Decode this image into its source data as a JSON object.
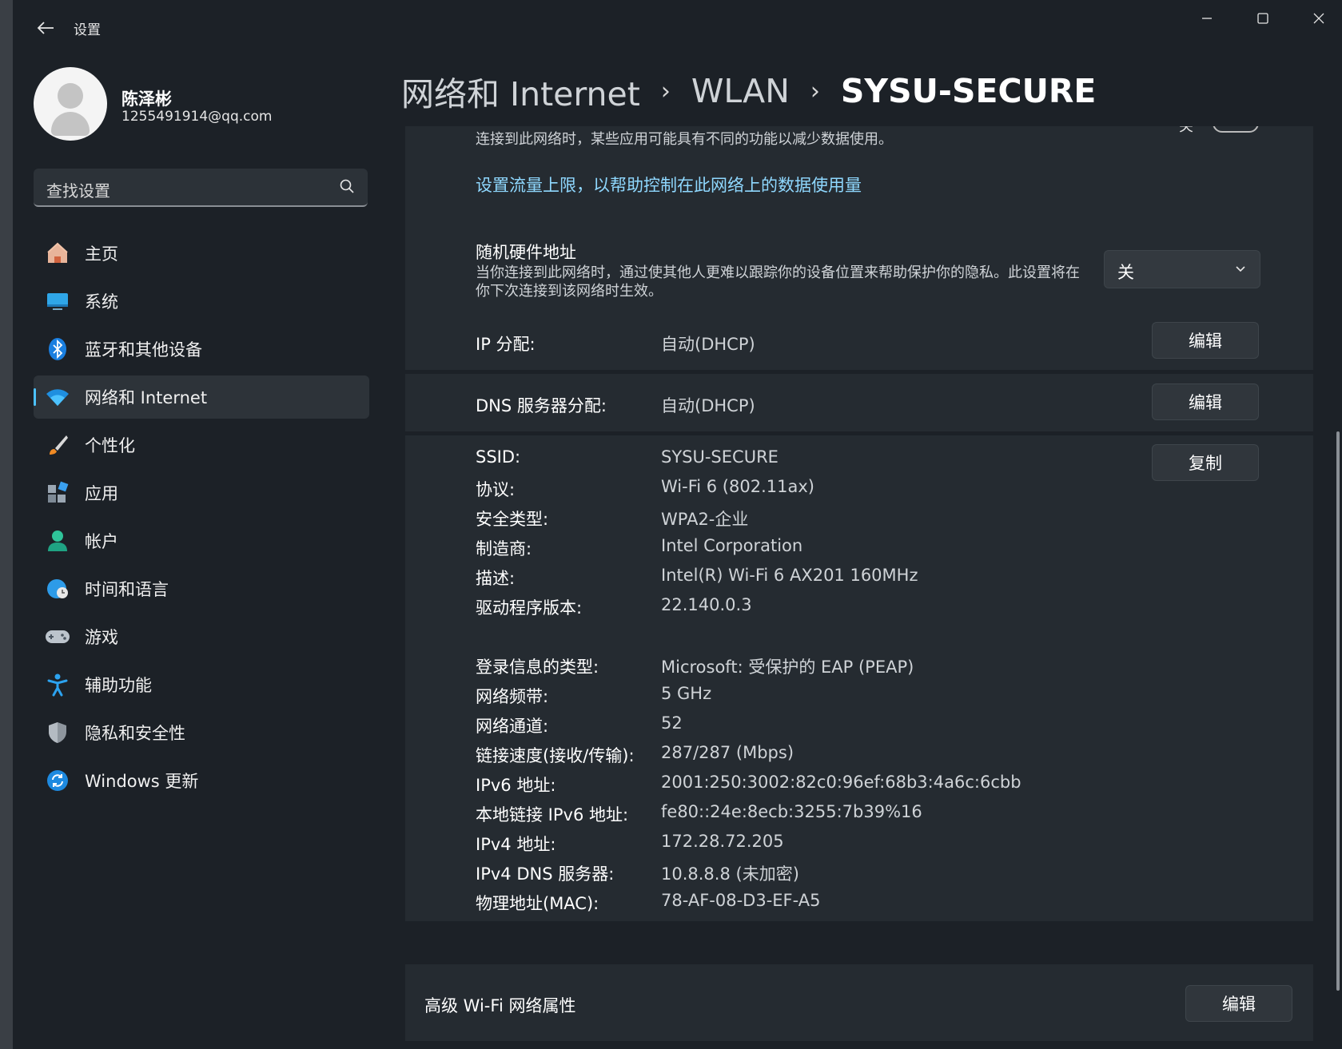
{
  "titlebar": {
    "app_title": "设置"
  },
  "profile": {
    "name": "陈泽彬",
    "email": "1255491914@qq.com"
  },
  "search": {
    "placeholder": "查找设置"
  },
  "nav": [
    {
      "label": "主页",
      "icon": "home-icon"
    },
    {
      "label": "系统",
      "icon": "system-icon"
    },
    {
      "label": "蓝牙和其他设备",
      "icon": "bluetooth-icon"
    },
    {
      "label": "网络和 Internet",
      "icon": "wifi-icon",
      "active": true
    },
    {
      "label": "个性化",
      "icon": "brush-icon"
    },
    {
      "label": "应用",
      "icon": "apps-icon"
    },
    {
      "label": "帐户",
      "icon": "account-icon"
    },
    {
      "label": "时间和语言",
      "icon": "time-language-icon"
    },
    {
      "label": "游戏",
      "icon": "gamepad-icon"
    },
    {
      "label": "辅助功能",
      "icon": "accessibility-icon"
    },
    {
      "label": "隐私和安全性",
      "icon": "shield-icon"
    },
    {
      "label": "Windows 更新",
      "icon": "update-icon"
    }
  ],
  "breadcrumb": {
    "level1": "网络和 Internet",
    "level2": "WLAN",
    "level3": "SYSU-SECURE"
  },
  "metered": {
    "description": "连接到此网络时，某些应用可能具有不同的功能以减少数据使用。",
    "toggle_state": "关",
    "data_limit_link": "设置流量上限，以帮助控制在此网络上的数据使用量"
  },
  "random_hw": {
    "title": "随机硬件地址",
    "description": "当你连接到此网络时，通过使其他人更难以跟踪你的设备位置来帮助保护你的隐私。此设置将在你下次连接到该网络时生效。",
    "value": "关"
  },
  "ip_assignment": {
    "label": "IP 分配:",
    "value": "自动(DHCP)",
    "button": "编辑"
  },
  "dns_assignment": {
    "label": "DNS 服务器分配:",
    "value": "自动(DHCP)",
    "button": "编辑"
  },
  "details": {
    "copy_button": "复制",
    "group1": [
      {
        "label": "SSID:",
        "value": "SYSU-SECURE"
      },
      {
        "label": "协议:",
        "value": "Wi-Fi 6 (802.11ax)"
      },
      {
        "label": "安全类型:",
        "value": "WPA2-企业"
      },
      {
        "label": "制造商:",
        "value": "Intel Corporation"
      },
      {
        "label": "描述:",
        "value": "Intel(R) Wi-Fi 6 AX201 160MHz"
      },
      {
        "label": "驱动程序版本:",
        "value": "22.140.0.3"
      }
    ],
    "group2": [
      {
        "label": "登录信息的类型:",
        "value": "Microsoft: 受保护的 EAP (PEAP)"
      },
      {
        "label": "网络频带:",
        "value": "5 GHz"
      },
      {
        "label": "网络通道:",
        "value": "52"
      },
      {
        "label": "链接速度(接收/传输):",
        "value": "287/287 (Mbps)"
      },
      {
        "label": "IPv6 地址:",
        "value": "2001:250:3002:82c0:96ef:68b3:4a6c:6cbb"
      },
      {
        "label": "本地链接 IPv6 地址:",
        "value": "fe80::24e:8ecb:3255:7b39%16"
      },
      {
        "label": "IPv4 地址:",
        "value": "172.28.72.205"
      },
      {
        "label": "IPv4 DNS 服务器:",
        "value": "10.8.8.8 (未加密)"
      },
      {
        "label": "物理地址(MAC):",
        "value": "78-AF-08-D3-EF-A5"
      }
    ]
  },
  "advanced": {
    "label": "高级 Wi-Fi 网络属性",
    "button": "编辑"
  },
  "colors": {
    "accent": "#4cc2ff",
    "link": "#8fd8ff",
    "background": "#1c2127",
    "card": "#252b31"
  }
}
